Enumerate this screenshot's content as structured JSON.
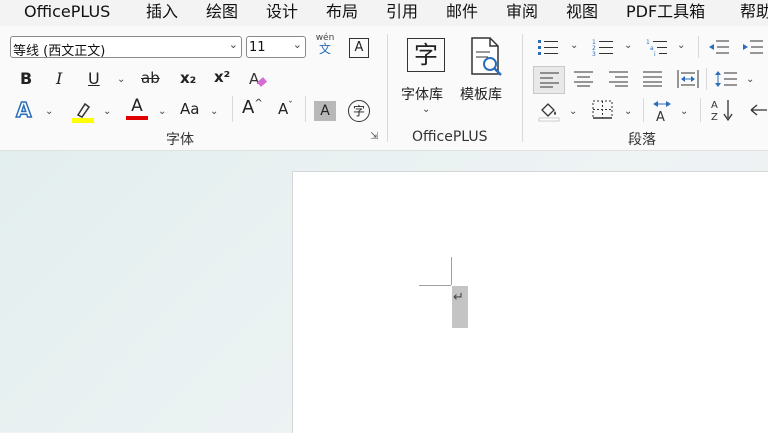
{
  "menubar": {
    "items": [
      "OfficePLUS",
      "插入",
      "绘图",
      "设计",
      "布局",
      "引用",
      "邮件",
      "审阅",
      "视图",
      "PDF工具箱",
      "帮助"
    ]
  },
  "font_group": {
    "font_name": "等线 (西文正文)",
    "font_size": "11",
    "phonetic_top": "wén",
    "phonetic_bottom": "文",
    "char_border": "A",
    "bold": "B",
    "italic": "I",
    "underline": "U",
    "strike": "ab",
    "subscript": "x₂",
    "superscript": "x²",
    "text_effect": "A",
    "highlight_color": "#ffff00",
    "font_color_letter": "A",
    "font_color": "#e00000",
    "change_case": "Aa",
    "grow_font": "A^",
    "shrink_font": "Aˇ",
    "char_shading": "A",
    "enclose_char": "字",
    "label": "字体"
  },
  "officeplus_group": {
    "font_lib_icon_char": "字",
    "font_lib_label": "字体库",
    "template_lib_label": "模板库",
    "label": "OfficePLUS"
  },
  "paragraph_group": {
    "label": "段落"
  },
  "document": {
    "paragraph_mark": "↵"
  }
}
